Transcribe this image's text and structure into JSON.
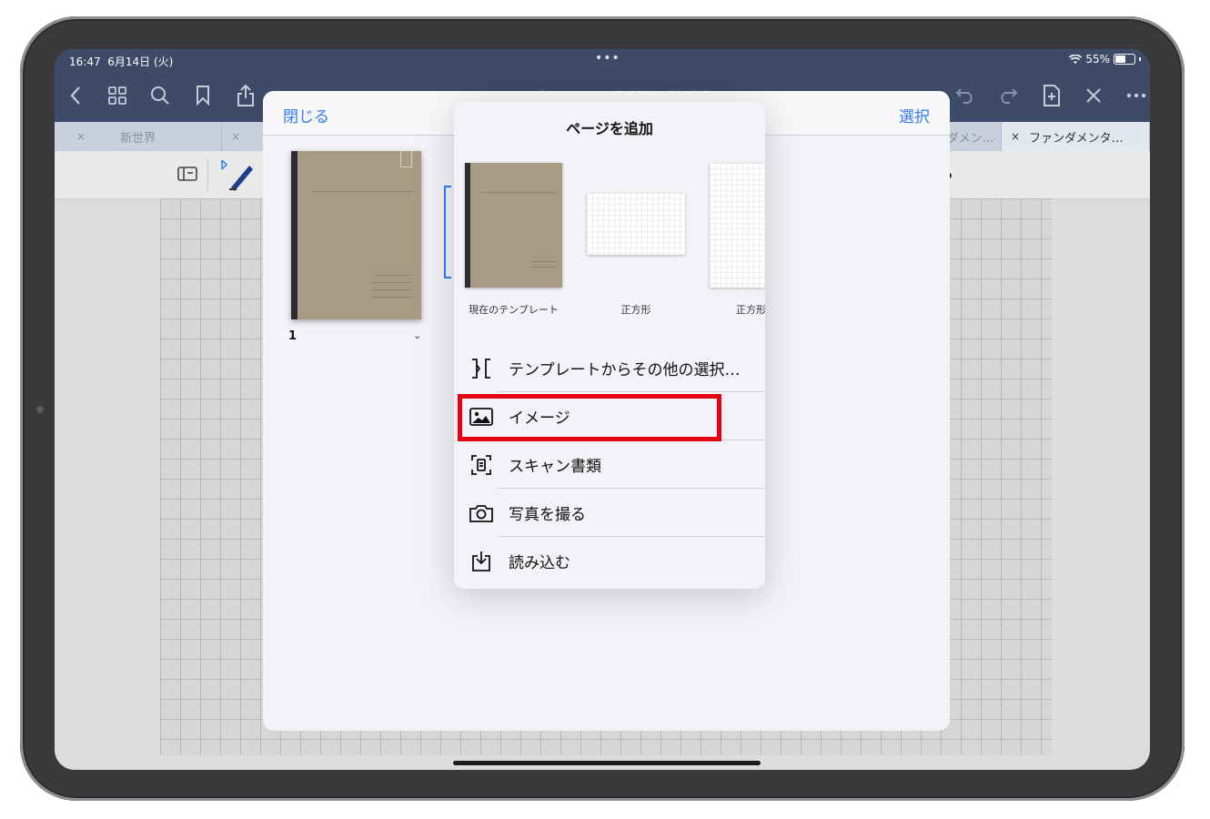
{
  "status": {
    "time": "16:47",
    "date": "6月14日 (火)",
    "battery": "55%"
  },
  "toolbar": {
    "title": "ファンダメンタルズ分析の教科書"
  },
  "tabs": [
    {
      "label": "新世界",
      "close": "×"
    },
    {
      "label": "",
      "close": "×"
    },
    {
      "label": "ダメン…",
      "close": ""
    },
    {
      "label": "ファンダメンタ…",
      "close": "×"
    }
  ],
  "modal": {
    "close_label": "閉じる",
    "select_label": "選択",
    "page_number": "1",
    "page_chevron": "⌄"
  },
  "popover": {
    "title": "ページを追加",
    "templates": [
      {
        "label": "現在のテンプレート"
      },
      {
        "label": "正方形"
      },
      {
        "label": "正方形"
      }
    ],
    "menu": [
      {
        "label": "テンプレートからその他の選択…",
        "icon": "template-icon"
      },
      {
        "label": "イメージ",
        "icon": "image-icon"
      },
      {
        "label": "スキャン書類",
        "icon": "scan-icon"
      },
      {
        "label": "写真を撮る",
        "icon": "camera-icon"
      },
      {
        "label": "読み込む",
        "icon": "import-icon"
      }
    ]
  },
  "colors": {
    "accent": "#2f7cf6",
    "highlight": "#e60012",
    "navbar": "#3d4a68"
  }
}
